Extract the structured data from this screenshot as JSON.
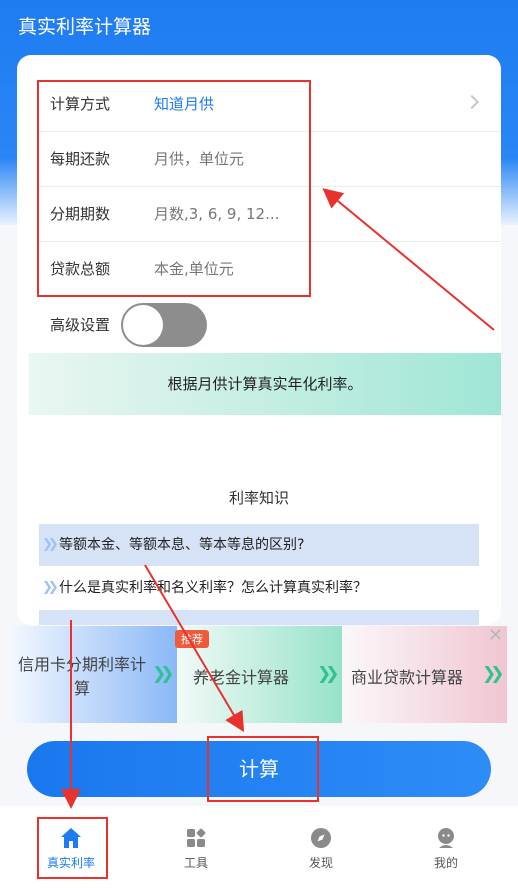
{
  "app_title": "真实利率计算器",
  "form": {
    "rows": [
      {
        "label": "计算方式",
        "value": "知道月供"
      },
      {
        "label": "每期还款",
        "placeholder": "月供，单位元"
      },
      {
        "label": "分期期数",
        "placeholder": "月数,3, 6, 9, 12..."
      },
      {
        "label": "贷款总额",
        "placeholder": "本金,单位元"
      }
    ],
    "advanced_label": "高级设置",
    "advanced_enabled": false
  },
  "banner_text": "根据月供计算真实年化利率。",
  "knowledge": {
    "title": "利率知识",
    "items": [
      "等额本金、等额本息、等本等息的区别?",
      "什么是真实利率和名义利率？怎么计算真实利率？"
    ]
  },
  "tools": {
    "badge": "推荐",
    "items": [
      {
        "label": "信用卡分期利率计算"
      },
      {
        "label": "养老金计算器"
      },
      {
        "label": "商业贷款计算器"
      }
    ]
  },
  "calc_button": "计算",
  "tabs": [
    {
      "label": "真实利率",
      "icon": "home-icon",
      "active": true
    },
    {
      "label": "工具",
      "icon": "grid-icon",
      "active": false
    },
    {
      "label": "发现",
      "icon": "compass-icon",
      "active": false
    },
    {
      "label": "我的",
      "icon": "user-icon",
      "active": false
    }
  ],
  "colors": {
    "primary": "#1e7cf2",
    "annotation": "#e8322d",
    "go_arrow": "#2ec28f"
  }
}
